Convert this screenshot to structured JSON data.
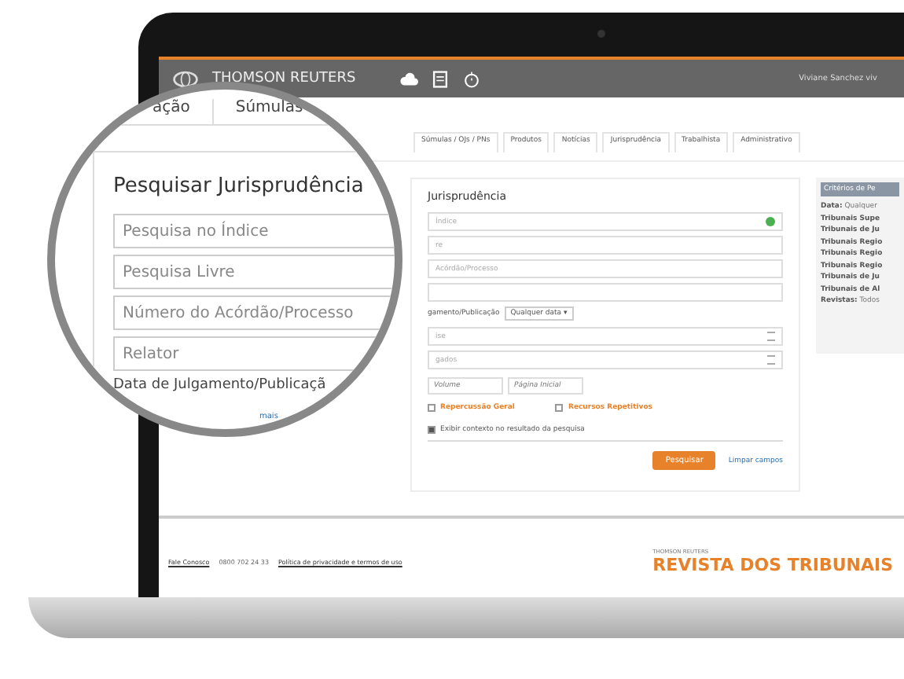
{
  "header": {
    "brand": "THOMSON REUTERS",
    "user": "Viviane Sanchez viv"
  },
  "nav_tabs": [
    "Súmulas / OJs / PNs",
    "Produtos",
    "Notícias",
    "Jurisprudência",
    "Trabalhista",
    "Administrativo"
  ],
  "form": {
    "title": "Jurisprudência",
    "fields": [
      {
        "kind": "text",
        "placeholder": "Índice",
        "add": true
      },
      {
        "kind": "text",
        "placeholder": "re"
      },
      {
        "kind": "text",
        "placeholder": "Acórdão/Processo"
      },
      {
        "kind": "text"
      },
      {
        "kind": "date",
        "label": "gamento/Publicação",
        "value": "Qualquer data ▾"
      },
      {
        "kind": "list",
        "placeholder": "ise"
      },
      {
        "kind": "list",
        "placeholder": "gados"
      }
    ],
    "volume": "Volume",
    "page": "Página Inicial",
    "checks": [
      {
        "label": "Repercussão Geral",
        "checked": false,
        "kind": "orange"
      },
      {
        "label": "Recursos Repetitivos",
        "checked": false,
        "kind": "orange"
      }
    ],
    "context": {
      "label": "Exibir contexto no resultado da pesquisa",
      "checked": true
    },
    "search_button": "Pesquisar",
    "clear_link": "Limpar campos"
  },
  "criteria": {
    "title": "Critérios de Pe",
    "lines": [
      {
        "key": "Data:",
        "value": " Qualquer"
      },
      {
        "key": "Tribunais Supe"
      },
      {
        "key": "Tribunais de Ju"
      },
      {
        "key": "Tribunais Regio"
      },
      {
        "key": "Tribunais Regio"
      },
      {
        "key": "Tribunais Regio"
      },
      {
        "key": "Tribunais de Ju"
      },
      {
        "key": "Tribunais de Al"
      },
      {
        "key": "Revistas:",
        "value": " Todos"
      }
    ]
  },
  "footer": {
    "links": [
      "Fale Conosco",
      "0800 702 24 33",
      "Política de privacidade e termos de uso"
    ],
    "brand_small": "THOMSON REUTERS",
    "brand": "REVISTA DOS TRIBUNAIS"
  },
  "magnifier": {
    "tabs": [
      "ação",
      "Súmulas"
    ],
    "title": "Pesquisar Jurisprudência",
    "fields": [
      "Pesquisa no Índice",
      "Pesquisa Livre",
      "Número do Acórdão/Processo",
      "Relator"
    ],
    "date_label": "Data de Julgamento/Publicaçã",
    "more_link": "mais"
  }
}
